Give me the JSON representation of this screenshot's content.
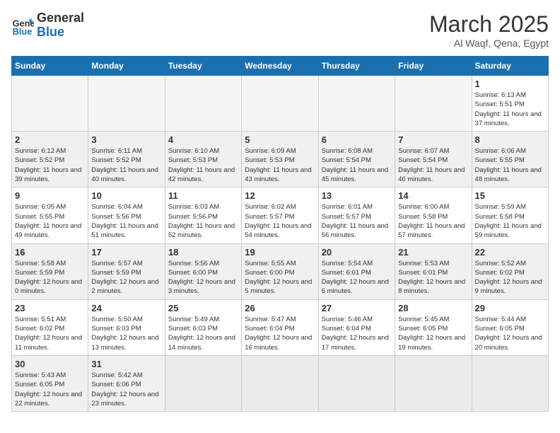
{
  "header": {
    "logo_general": "General",
    "logo_blue": "Blue",
    "month": "March 2025",
    "location": "Al Waqf, Qena, Egypt"
  },
  "weekdays": [
    "Sunday",
    "Monday",
    "Tuesday",
    "Wednesday",
    "Thursday",
    "Friday",
    "Saturday"
  ],
  "weeks": [
    [
      {
        "day": "",
        "info": ""
      },
      {
        "day": "",
        "info": ""
      },
      {
        "day": "",
        "info": ""
      },
      {
        "day": "",
        "info": ""
      },
      {
        "day": "",
        "info": ""
      },
      {
        "day": "",
        "info": ""
      },
      {
        "day": "1",
        "info": "Sunrise: 6:13 AM\nSunset: 5:51 PM\nDaylight: 11 hours and 37 minutes."
      }
    ],
    [
      {
        "day": "2",
        "info": "Sunrise: 6:12 AM\nSunset: 5:52 PM\nDaylight: 11 hours and 39 minutes."
      },
      {
        "day": "3",
        "info": "Sunrise: 6:11 AM\nSunset: 5:52 PM\nDaylight: 11 hours and 40 minutes."
      },
      {
        "day": "4",
        "info": "Sunrise: 6:10 AM\nSunset: 5:53 PM\nDaylight: 11 hours and 42 minutes."
      },
      {
        "day": "5",
        "info": "Sunrise: 6:09 AM\nSunset: 5:53 PM\nDaylight: 11 hours and 43 minutes."
      },
      {
        "day": "6",
        "info": "Sunrise: 6:08 AM\nSunset: 5:54 PM\nDaylight: 11 hours and 45 minutes."
      },
      {
        "day": "7",
        "info": "Sunrise: 6:07 AM\nSunset: 5:54 PM\nDaylight: 11 hours and 46 minutes."
      },
      {
        "day": "8",
        "info": "Sunrise: 6:06 AM\nSunset: 5:55 PM\nDaylight: 11 hours and 48 minutes."
      }
    ],
    [
      {
        "day": "9",
        "info": "Sunrise: 6:05 AM\nSunset: 5:55 PM\nDaylight: 11 hours and 49 minutes."
      },
      {
        "day": "10",
        "info": "Sunrise: 6:04 AM\nSunset: 5:56 PM\nDaylight: 11 hours and 51 minutes."
      },
      {
        "day": "11",
        "info": "Sunrise: 6:03 AM\nSunset: 5:56 PM\nDaylight: 11 hours and 52 minutes."
      },
      {
        "day": "12",
        "info": "Sunrise: 6:02 AM\nSunset: 5:57 PM\nDaylight: 11 hours and 54 minutes."
      },
      {
        "day": "13",
        "info": "Sunrise: 6:01 AM\nSunset: 5:57 PM\nDaylight: 11 hours and 56 minutes."
      },
      {
        "day": "14",
        "info": "Sunrise: 6:00 AM\nSunset: 5:58 PM\nDaylight: 11 hours and 57 minutes."
      },
      {
        "day": "15",
        "info": "Sunrise: 5:59 AM\nSunset: 5:58 PM\nDaylight: 11 hours and 59 minutes."
      }
    ],
    [
      {
        "day": "16",
        "info": "Sunrise: 5:58 AM\nSunset: 5:59 PM\nDaylight: 12 hours and 0 minutes."
      },
      {
        "day": "17",
        "info": "Sunrise: 5:57 AM\nSunset: 5:59 PM\nDaylight: 12 hours and 2 minutes."
      },
      {
        "day": "18",
        "info": "Sunrise: 5:56 AM\nSunset: 6:00 PM\nDaylight: 12 hours and 3 minutes."
      },
      {
        "day": "19",
        "info": "Sunrise: 5:55 AM\nSunset: 6:00 PM\nDaylight: 12 hours and 5 minutes."
      },
      {
        "day": "20",
        "info": "Sunrise: 5:54 AM\nSunset: 6:01 PM\nDaylight: 12 hours and 6 minutes."
      },
      {
        "day": "21",
        "info": "Sunrise: 5:53 AM\nSunset: 6:01 PM\nDaylight: 12 hours and 8 minutes."
      },
      {
        "day": "22",
        "info": "Sunrise: 5:52 AM\nSunset: 6:02 PM\nDaylight: 12 hours and 9 minutes."
      }
    ],
    [
      {
        "day": "23",
        "info": "Sunrise: 5:51 AM\nSunset: 6:02 PM\nDaylight: 12 hours and 11 minutes."
      },
      {
        "day": "24",
        "info": "Sunrise: 5:50 AM\nSunset: 6:03 PM\nDaylight: 12 hours and 13 minutes."
      },
      {
        "day": "25",
        "info": "Sunrise: 5:49 AM\nSunset: 6:03 PM\nDaylight: 12 hours and 14 minutes."
      },
      {
        "day": "26",
        "info": "Sunrise: 5:47 AM\nSunset: 6:04 PM\nDaylight: 12 hours and 16 minutes."
      },
      {
        "day": "27",
        "info": "Sunrise: 5:46 AM\nSunset: 6:04 PM\nDaylight: 12 hours and 17 minutes."
      },
      {
        "day": "28",
        "info": "Sunrise: 5:45 AM\nSunset: 6:05 PM\nDaylight: 12 hours and 19 minutes."
      },
      {
        "day": "29",
        "info": "Sunrise: 5:44 AM\nSunset: 6:05 PM\nDaylight: 12 hours and 20 minutes."
      }
    ],
    [
      {
        "day": "30",
        "info": "Sunrise: 5:43 AM\nSunset: 6:05 PM\nDaylight: 12 hours and 22 minutes."
      },
      {
        "day": "31",
        "info": "Sunrise: 5:42 AM\nSunset: 6:06 PM\nDaylight: 12 hours and 23 minutes."
      },
      {
        "day": "",
        "info": ""
      },
      {
        "day": "",
        "info": ""
      },
      {
        "day": "",
        "info": ""
      },
      {
        "day": "",
        "info": ""
      },
      {
        "day": "",
        "info": ""
      }
    ]
  ]
}
